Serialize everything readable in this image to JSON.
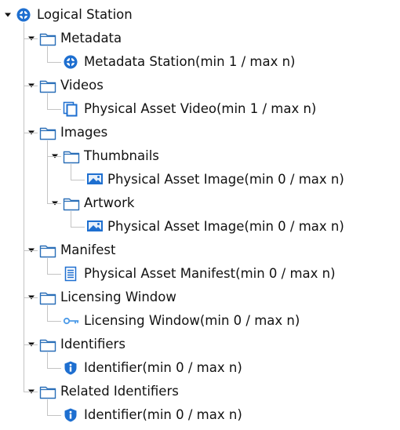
{
  "tree": {
    "root": {
      "label": "Logical Station",
      "icon": "logical-station-icon",
      "expanded": true,
      "children": [
        {
          "id": "metadata",
          "label": "Metadata",
          "icon": "folder-icon",
          "expanded": true,
          "children": [
            {
              "label": "Metadata Station(min 1 / max n)",
              "icon": "station-icon"
            }
          ]
        },
        {
          "id": "videos",
          "label": "Videos",
          "icon": "folder-icon",
          "expanded": true,
          "children": [
            {
              "label": "Physical Asset Video(min 1 / max n)",
              "icon": "video-asset-icon"
            }
          ]
        },
        {
          "id": "images",
          "label": "Images",
          "icon": "folder-icon",
          "expanded": true,
          "children": [
            {
              "id": "thumbnails",
              "label": "Thumbnails",
              "icon": "folder-icon",
              "expanded": true,
              "children": [
                {
                  "label": "Physical Asset Image(min 0 / max n)",
                  "icon": "image-asset-icon"
                }
              ]
            },
            {
              "id": "artwork",
              "label": "Artwork",
              "icon": "folder-icon",
              "expanded": true,
              "children": [
                {
                  "label": "Physical Asset Image(min 0 / max n)",
                  "icon": "image-asset-icon"
                }
              ]
            }
          ]
        },
        {
          "id": "manifest",
          "label": "Manifest",
          "icon": "folder-icon",
          "expanded": true,
          "children": [
            {
              "label": "Physical Asset Manifest(min 0 / max n)",
              "icon": "manifest-icon"
            }
          ]
        },
        {
          "id": "licensing-window",
          "label": "Licensing Window",
          "icon": "folder-icon",
          "expanded": true,
          "children": [
            {
              "label": "Licensing Window(min 0 / max n)",
              "icon": "key-icon"
            }
          ]
        },
        {
          "id": "identifiers",
          "label": "Identifiers",
          "icon": "folder-icon",
          "expanded": true,
          "children": [
            {
              "label": "Identifier(min 0 / max n)",
              "icon": "identifier-shield-icon"
            }
          ]
        },
        {
          "id": "related-identifiers",
          "label": "Related Identifiers",
          "icon": "folder-icon",
          "expanded": true,
          "children": [
            {
              "label": "Identifier(min 0 / max n)",
              "icon": "identifier-shield-icon"
            }
          ]
        }
      ]
    }
  },
  "colors": {
    "accent": "#1e6fd0",
    "accent_light": "#4d9be8",
    "folder_stroke": "#2a6fb8",
    "line": "#c4c4c4",
    "text": "#111111"
  }
}
